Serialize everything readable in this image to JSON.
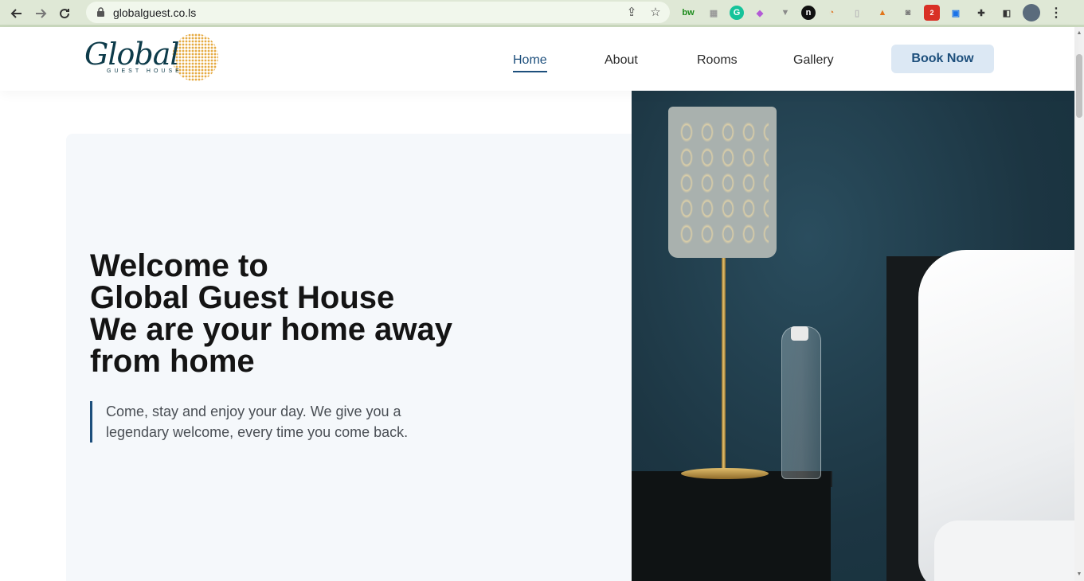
{
  "browser": {
    "url": "globalguest.co.ls",
    "back_icon": "arrow-left-icon",
    "forward_icon": "arrow-right-icon",
    "reload_icon": "reload-icon",
    "extension_badge": "2"
  },
  "site": {
    "logo_text": "Global",
    "logo_sub": "GUEST HOUSE",
    "nav": [
      {
        "label": "Home",
        "active": true
      },
      {
        "label": "About",
        "active": false
      },
      {
        "label": "Rooms",
        "active": false
      },
      {
        "label": "Gallery",
        "active": false
      }
    ],
    "book_now": "Book Now"
  },
  "hero": {
    "title_lines": [
      "Welcome to",
      "Global Guest House",
      "We are your home away",
      "from home"
    ],
    "quote": "Come, stay and enjoy your day. We give you a legendary welcome, every time you come back."
  },
  "colors": {
    "accent": "#1d4f7c",
    "button_bg": "#dce8f4",
    "logo_gold": "#e4a73a",
    "logo_dark": "#0d3b4a"
  }
}
